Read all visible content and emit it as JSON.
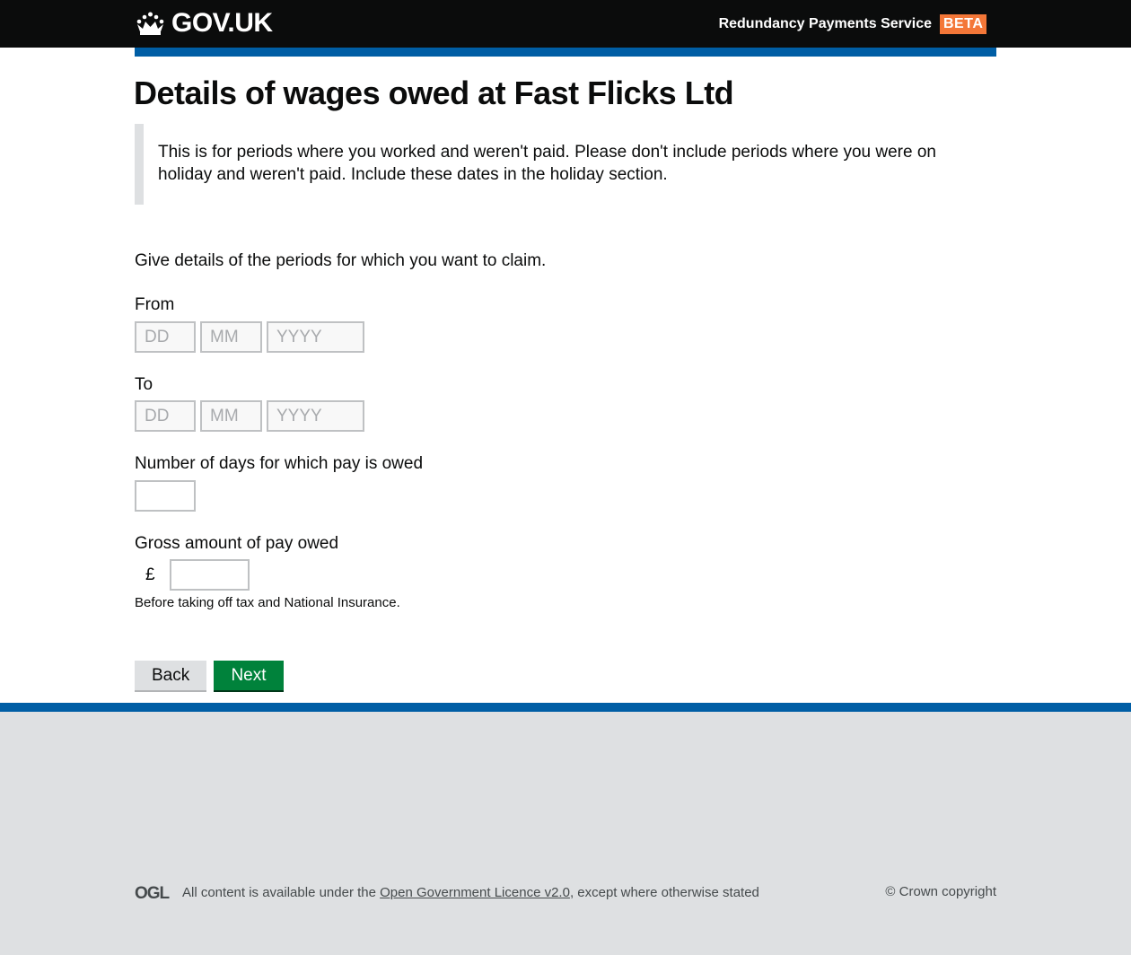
{
  "header": {
    "logo_text": "GOV.UK",
    "service_name": "Redundancy Payments Service",
    "phase_tag": "BETA"
  },
  "page": {
    "title": "Details of wages owed at Fast Flicks Ltd",
    "inset_text": "This is for periods where you worked and weren't paid. Please don't include periods where you were on holiday and weren't paid. Include these dates in the holiday section.",
    "intro": "Give details of the periods for which you want to claim."
  },
  "form": {
    "from_label": "From",
    "to_label": "To",
    "placeholders": {
      "day": "DD",
      "month": "MM",
      "year": "YYYY"
    },
    "days_label": "Number of days for which pay is owed",
    "gross_label": "Gross amount of pay owed",
    "currency_symbol": "£",
    "gross_hint": "Before taking off tax and National Insurance.",
    "back_label": "Back",
    "next_label": "Next"
  },
  "footer": {
    "licence_prefix": "All content is available under the ",
    "licence_link": "Open Government Licence v2.0",
    "licence_suffix": ", except where otherwise stated",
    "copyright": "© Crown copyright"
  },
  "colors": {
    "header_bg": "#0b0c0c",
    "brand_blue": "#005ea5",
    "beta_orange": "#f47738",
    "button_green": "#00823b",
    "footer_bg": "#dee0e2"
  }
}
